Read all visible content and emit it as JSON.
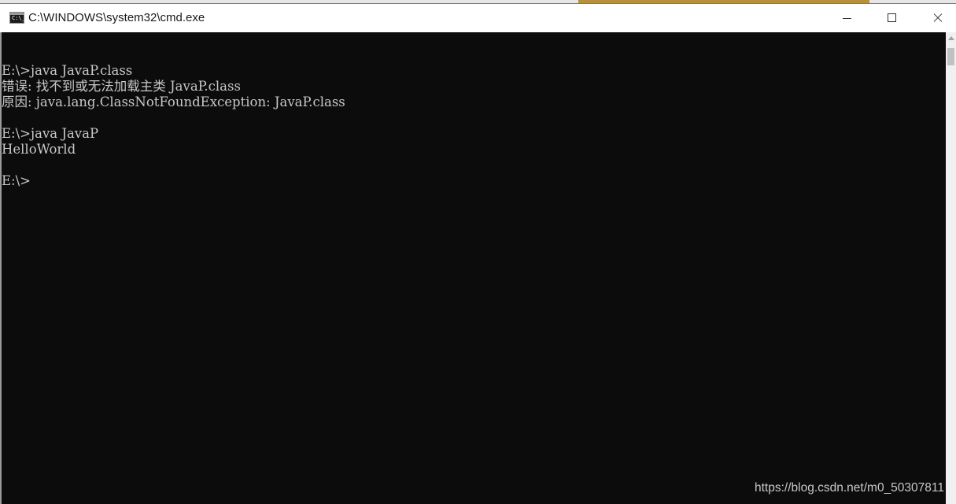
{
  "window": {
    "title": "C:\\WINDOWS\\system32\\cmd.exe",
    "icon": "cmd-console-icon",
    "icon_label": "C:\\_"
  },
  "controls": {
    "minimize_icon": "minimize-icon",
    "maximize_icon": "maximize-icon",
    "close_icon": "close-icon"
  },
  "console": {
    "lines": [
      "",
      "E:\\>java JavaP.class",
      "错误: 找不到或无法加载主类 JavaP.class",
      "原因: java.lang.ClassNotFoundException: JavaP.class",
      "",
      "E:\\>java JavaP",
      "HelloWorld",
      "",
      "E:\\>"
    ]
  },
  "watermark": "https://blog.csdn.net/m0_50307811",
  "colors": {
    "console_bg": "#0c0c0c",
    "console_text": "#c8c8c8",
    "titlebar_bg": "#ffffff"
  }
}
